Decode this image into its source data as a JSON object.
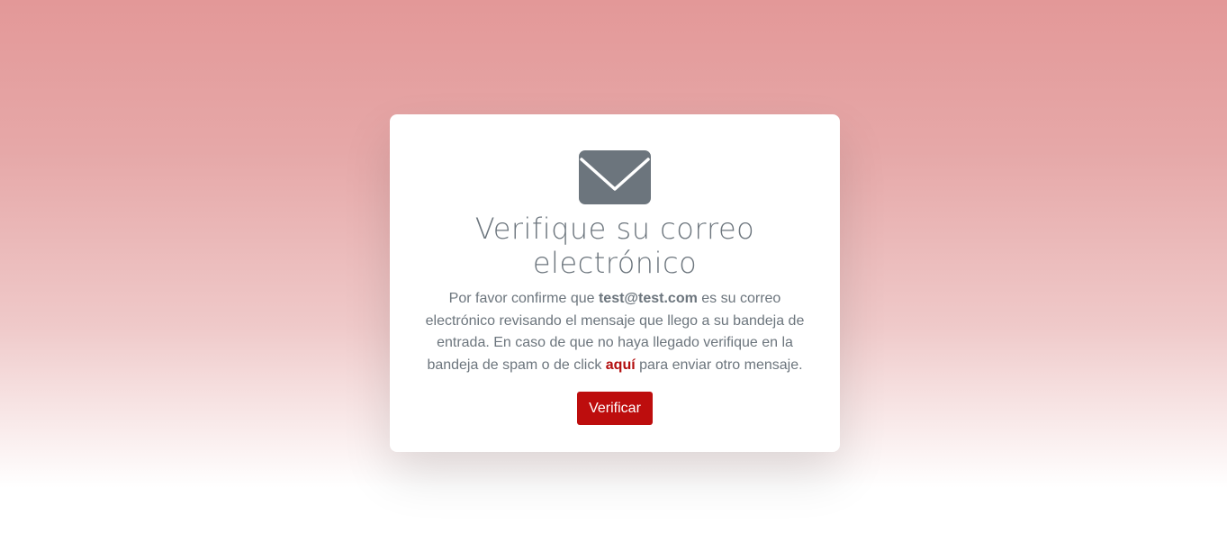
{
  "card": {
    "icon": "envelope-icon",
    "title_line1": "Verifique su correo",
    "title_line2": "electrónico",
    "message": {
      "part1": "Por favor confirme que ",
      "email": "test@test.com",
      "part2": " es su correo electrónico revisando el mensaje que llego a su bandeja de entrada. En caso de que no haya llegado verifique en la bandeja de spam o de click ",
      "link_text": "aquí",
      "part3": " para enviar otro mensaje."
    },
    "button_label": "Verificar"
  },
  "colors": {
    "background_top": "#e39898",
    "background_bottom": "#ffffff",
    "text": "#6c757d",
    "accent": "#bd0d0d",
    "link": "#b30f0f"
  }
}
